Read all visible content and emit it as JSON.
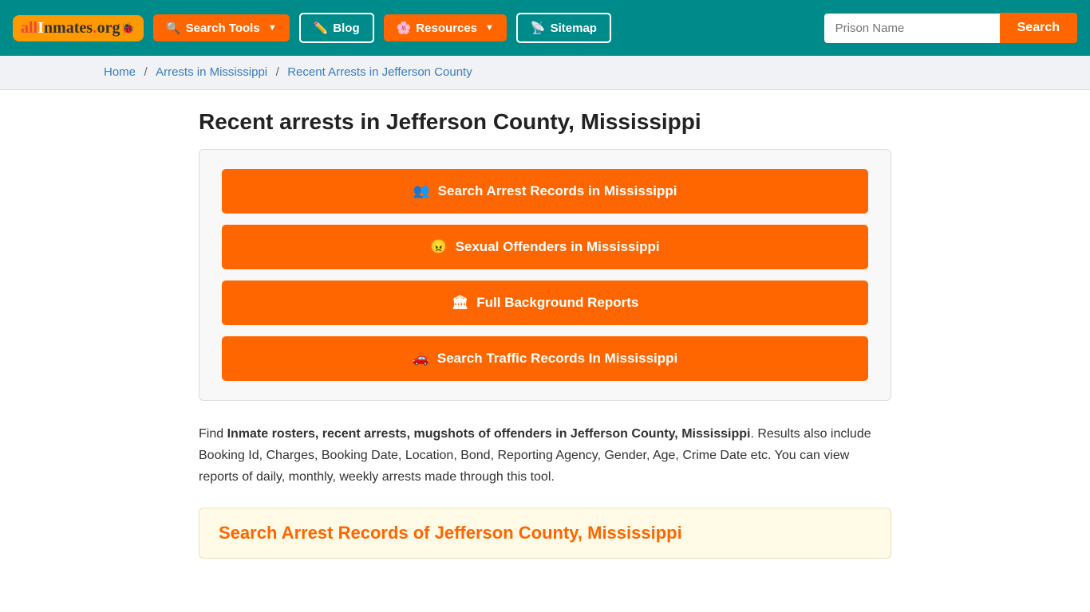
{
  "header": {
    "logo_text": "allInmates.org",
    "nav": {
      "search_tools_label": "Search Tools",
      "blog_label": "Blog",
      "resources_label": "Resources",
      "sitemap_label": "Sitemap"
    },
    "search_placeholder": "Prison Name",
    "search_button_label": "Search"
  },
  "breadcrumb": {
    "home": "Home",
    "arrests_in_ms": "Arrests in Mississippi",
    "recent_arrests": "Recent Arrests in Jefferson County"
  },
  "main": {
    "page_title": "Recent arrests in Jefferson County, Mississippi",
    "action_buttons": [
      {
        "icon": "👥",
        "label": "Search Arrest Records in Mississippi",
        "key": "arrest-records"
      },
      {
        "icon": "😠",
        "label": "Sexual Offenders in Mississippi",
        "key": "sexual-offenders"
      },
      {
        "icon": "🏛",
        "label": "Full Background Reports",
        "key": "background-reports"
      },
      {
        "icon": "🚗",
        "label": "Search Traffic Records In Mississippi",
        "key": "traffic-records"
      }
    ],
    "description_intro": "Find ",
    "description_bold": "Inmate rosters, recent arrests, mugshots of offenders in Jefferson County, Mississippi",
    "description_rest": ". Results also include Booking Id, Charges, Booking Date, Location, Bond, Reporting Agency, Gender, Age, Crime Date etc. You can view reports of daily, monthly, weekly arrests made through this tool.",
    "search_section_title": "Search Arrest Records of Jefferson County, Mississippi"
  }
}
